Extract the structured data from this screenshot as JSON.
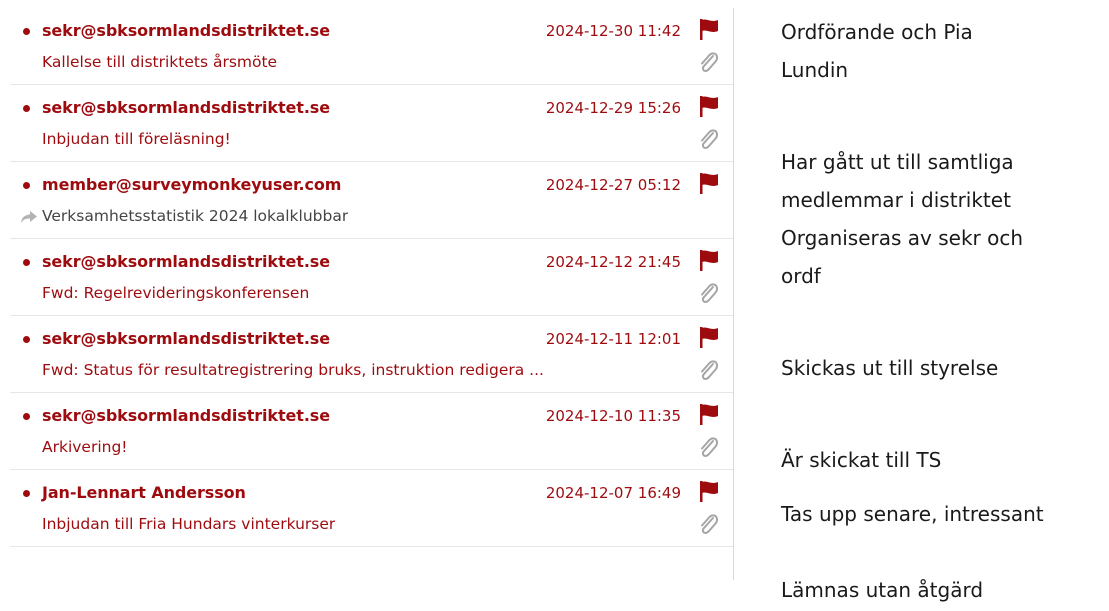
{
  "colors": {
    "accent": "#9e0b0f",
    "forward_icon": "#b3b3b3",
    "paperclip": "#a6a6a6"
  },
  "emails": [
    {
      "sender": "sekr@sbksormlandsdistriktet.se",
      "date": "2024-12-30 11:42",
      "subject": "Kallelse till distriktets årsmöte",
      "flag_icon": "flag-icon",
      "attachment_icon": "paperclip-icon",
      "forwarded": false
    },
    {
      "sender": "sekr@sbksormlandsdistriktet.se",
      "date": "2024-12-29 15:26",
      "subject": "Inbjudan till föreläsning!",
      "flag_icon": "flag-icon",
      "attachment_icon": "paperclip-icon",
      "forwarded": false
    },
    {
      "sender": "member@surveymonkeyuser.com",
      "date": "2024-12-27 05:12",
      "subject": "Verksamhetsstatistik 2024 lokalklubbar",
      "flag_icon": "flag-icon",
      "attachment_icon": "",
      "forwarded": true
    },
    {
      "sender": "sekr@sbksormlandsdistriktet.se",
      "date": "2024-12-12 21:45",
      "subject": "Fwd: Regelrevideringskonferensen",
      "flag_icon": "flag-icon",
      "attachment_icon": "paperclip-icon",
      "forwarded": false
    },
    {
      "sender": "sekr@sbksormlandsdistriktet.se",
      "date": "2024-12-11 12:01",
      "subject": "Fwd: Status för resultatregistrering bruks, instruktion redigera ...",
      "flag_icon": "flag-icon",
      "attachment_icon": "paperclip-icon",
      "forwarded": false
    },
    {
      "sender": "sekr@sbksormlandsdistriktet.se",
      "date": "2024-12-10 11:35",
      "subject": "Arkivering!",
      "flag_icon": "flag-icon",
      "attachment_icon": "paperclip-icon",
      "forwarded": false
    },
    {
      "sender": "Jan-Lennart Andersson",
      "date": "2024-12-07 16:49",
      "subject": "Inbjudan till Fria Hundars vinterkurser",
      "flag_icon": "flag-icon",
      "attachment_icon": "paperclip-icon",
      "forwarded": false
    }
  ],
  "notes": [
    "Ordförande och Pia",
    "Lundin",
    "Har gått ut till samtliga",
    "medlemmar i distriktet",
    "Organiseras av sekr och",
    "ordf",
    "Skickas ut till styrelse",
    "Är skickat till TS",
    "Tas upp senare, intressant",
    "Lämnas utan åtgärd"
  ]
}
